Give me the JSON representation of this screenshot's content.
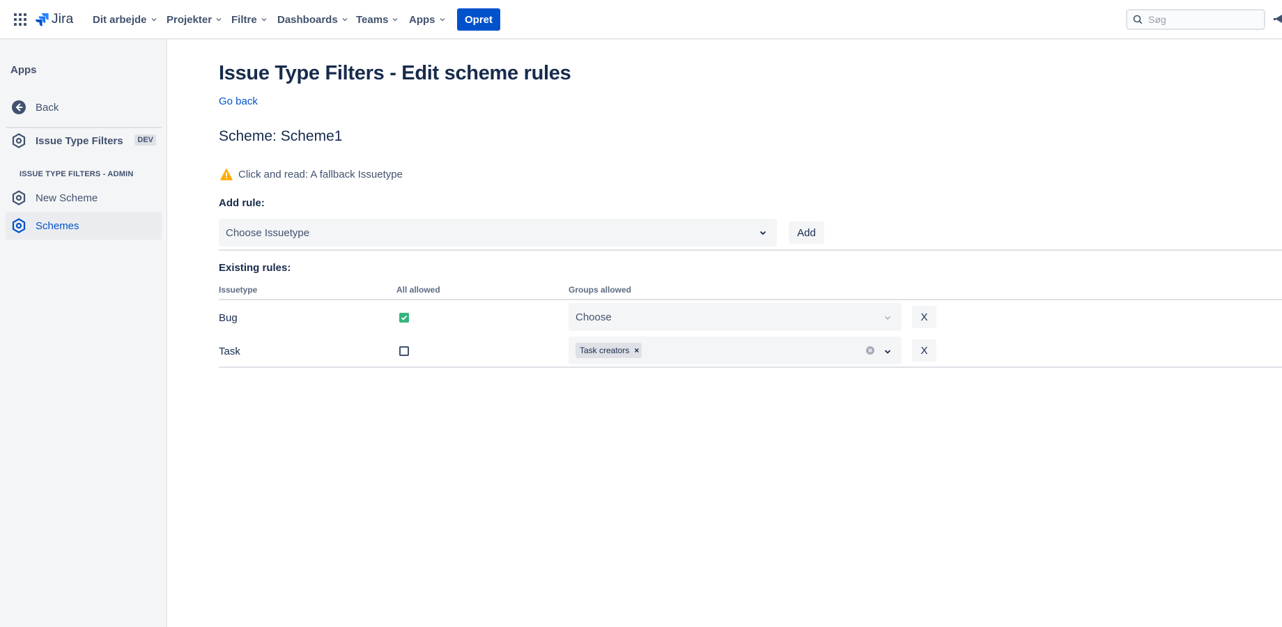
{
  "topnav": {
    "app_name": "Jira",
    "items": [
      {
        "label": "Dit arbejde"
      },
      {
        "label": "Projekter"
      },
      {
        "label": "Filtre"
      },
      {
        "label": "Dashboards"
      },
      {
        "label": "Teams"
      },
      {
        "label": "Apps"
      }
    ],
    "create_label": "Opret",
    "search_placeholder": "Søg"
  },
  "sidebar": {
    "heading": "Apps",
    "back_label": "Back",
    "app_label": "Issue Type Filters",
    "app_badge": "DEV",
    "group_label": "ISSUE TYPE FILTERS - ADMIN",
    "items": [
      {
        "label": "New Scheme",
        "active": false
      },
      {
        "label": "Schemes",
        "active": true
      }
    ]
  },
  "main": {
    "title": "Issue Type Filters - Edit scheme rules",
    "go_back": "Go back",
    "scheme_title": "Scheme: Scheme1",
    "warning_text": "Click and read: A fallback Issuetype",
    "add_rule_label": "Add rule:",
    "issuetype_placeholder": "Choose Issuetype",
    "add_button": "Add",
    "existing_label": "Existing rules:",
    "columns": [
      "Issuetype",
      "All allowed",
      "Groups allowed"
    ],
    "rules": [
      {
        "issuetype": "Bug",
        "all_allowed": true,
        "groups_placeholder": "Choose",
        "groups": [],
        "remove": "X"
      },
      {
        "issuetype": "Task",
        "all_allowed": false,
        "groups_placeholder": "",
        "groups": [
          "Task creators"
        ],
        "remove": "X"
      }
    ]
  },
  "colors": {
    "primary": "#0052CC",
    "text": "#172B4D",
    "subtle": "#42526E",
    "warning": "#FFAB00",
    "success": "#36B37E",
    "sidebar_bg": "#F4F5F7"
  }
}
